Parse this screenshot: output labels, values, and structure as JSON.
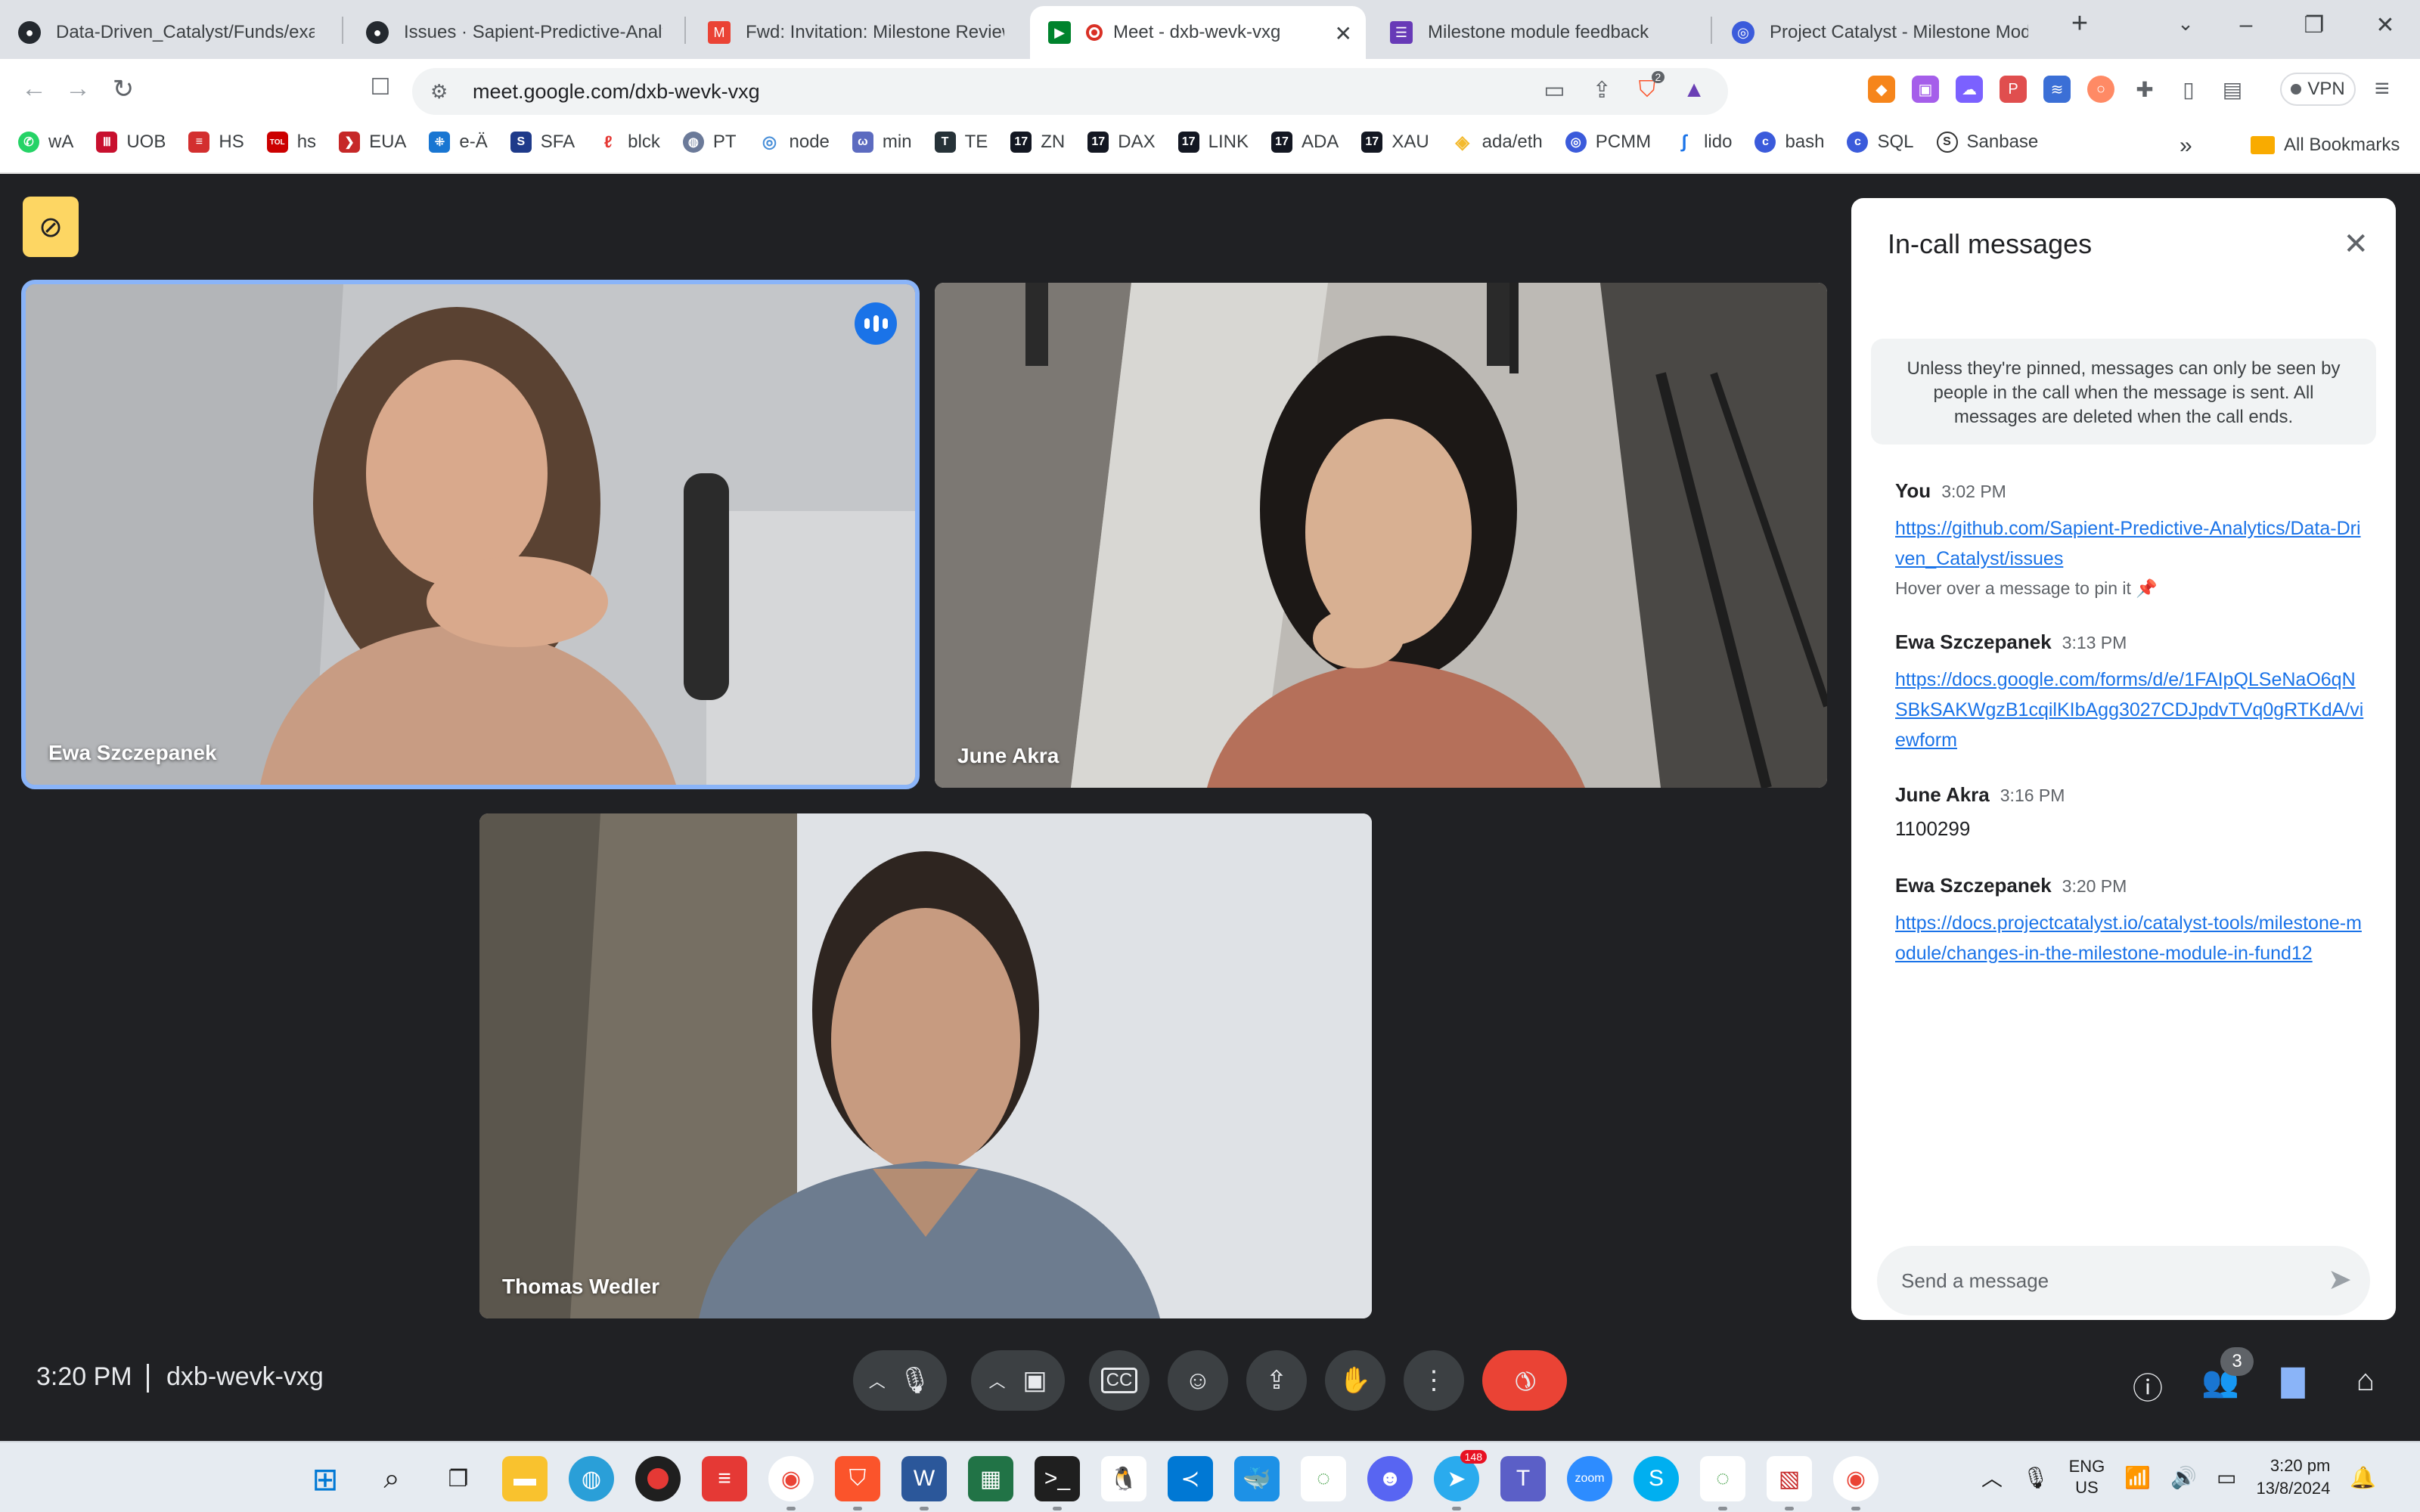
{
  "browser": {
    "tabs": [
      {
        "title": "Data-Driven_Catalyst/Funds/exan",
        "icon": "github-icon"
      },
      {
        "title": "Issues · Sapient-Predictive-Analyt",
        "icon": "github-icon"
      },
      {
        "title": "Fwd: Invitation: Milestone Review",
        "icon": "gmail-icon"
      },
      {
        "title": "Meet - dxb-wevk-vxg",
        "icon": "meet-icon"
      },
      {
        "title": "Milestone module feedback",
        "icon": "forms-icon"
      },
      {
        "title": "Project Catalyst - Milestone Modu",
        "icon": "catalyst-icon"
      }
    ],
    "url": "meet.google.com/dxb-wevk-vxg",
    "vpn_label": "VPN",
    "brave_badge": "2",
    "bookmarks": [
      "wA",
      "UOB",
      "HS",
      "hs",
      "EUA",
      "e-Ä",
      "SFA",
      "blck",
      "PT",
      "node",
      "min",
      "TE",
      "ZN",
      "DAX",
      "LINK",
      "ADA",
      "XAU",
      "ada/eth",
      "PCMM",
      "lido",
      "bash",
      "SQL",
      "Sanbase"
    ],
    "all_bookmarks": "All Bookmarks"
  },
  "meet": {
    "participants": [
      {
        "name": "Ewa Szczepanek",
        "speaking": true
      },
      {
        "name": "June Akra",
        "speaking": false
      },
      {
        "name": "Thomas Wedler",
        "speaking": false
      }
    ],
    "time": "3:20 PM",
    "meeting_code": "dxb-wevk-vxg",
    "people_count": "3"
  },
  "chat": {
    "title": "In-call messages",
    "notice": "Unless they're pinned, messages can only be seen by people in the call when the message is sent. All messages are deleted when the call ends.",
    "messages": [
      {
        "sender": "You",
        "time": "3:02 PM",
        "link": "https://github.com/Sapient-Predictive-Analytics/Data-Driven_Catalyst/issues",
        "hint": "Hover over a message to pin it"
      },
      {
        "sender": "Ewa Szczepanek",
        "time": "3:13 PM",
        "link": "https://docs.google.com/forms/d/e/1FAIpQLSeNaO6qNSBkSAKWgzB1cqilKIbAgg3027CDJpdvTVq0gRTKdA/viewform"
      },
      {
        "sender": "June Akra",
        "time": "3:16 PM",
        "text": "1100299"
      },
      {
        "sender": "Ewa Szczepanek",
        "time": "3:20 PM",
        "link": "https://docs.projectcatalyst.io/catalyst-tools/milestone-module/changes-in-the-milestone-module-in-fund12"
      }
    ],
    "input_placeholder": "Send a message"
  },
  "taskbar": {
    "telegram_badge": "148",
    "lang_line1": "ENG",
    "lang_line2": "US",
    "clock_time": "3:20 pm",
    "clock_date": "13/8/2024"
  },
  "colors": {
    "meet_bg": "#202124",
    "accent_blue": "#1a73e8",
    "speaking_outline": "#8ab4f8",
    "end_call_red": "#ea4335",
    "recording_yellow": "#fdd663"
  }
}
